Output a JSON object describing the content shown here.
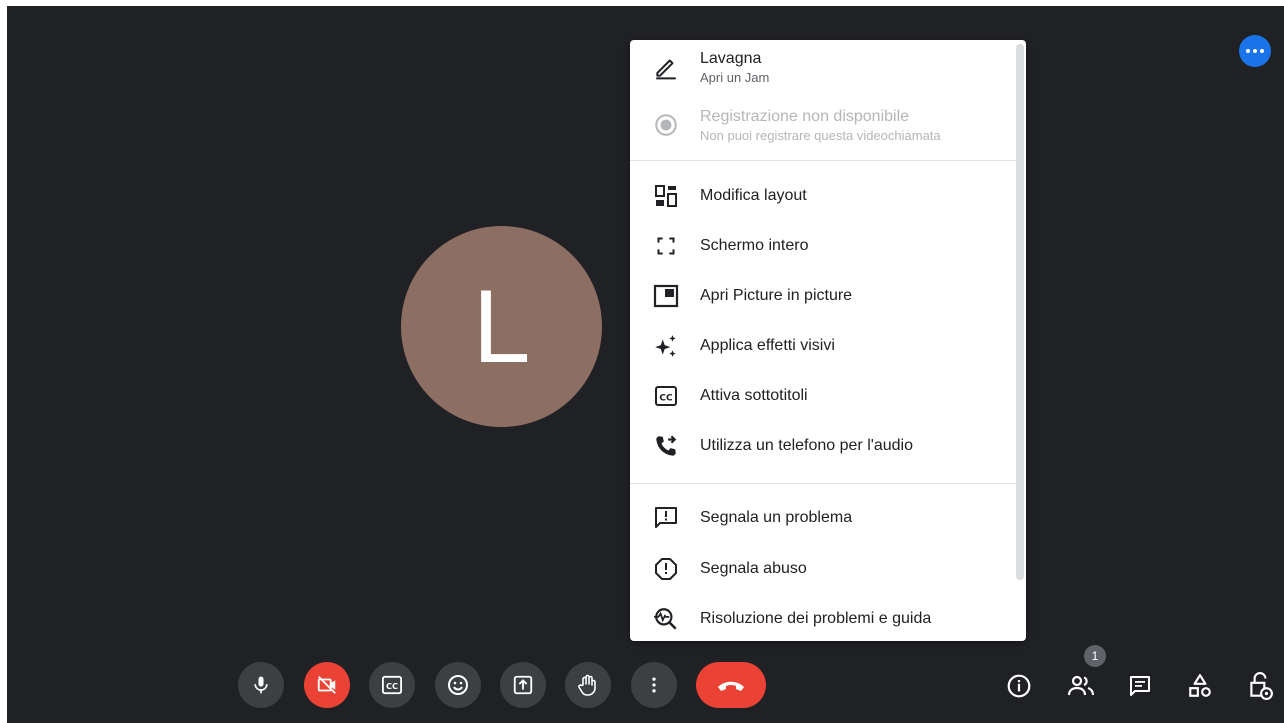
{
  "participant": {
    "initial": "L"
  },
  "menu": {
    "items": [
      {
        "label": "Lavagna",
        "sub": "Apri un Jam",
        "icon": "pencil-icon",
        "disabled": false
      },
      {
        "label": "Registrazione non disponibile",
        "sub": "Non puoi registrare questa videochiamata",
        "icon": "record-icon",
        "disabled": true
      },
      {
        "label": "Modifica layout",
        "icon": "layout-icon"
      },
      {
        "label": "Schermo intero",
        "icon": "fullscreen-icon"
      },
      {
        "label": "Apri Picture in picture",
        "icon": "picture-in-picture-icon"
      },
      {
        "label": "Applica effetti visivi",
        "icon": "sparkle-icon"
      },
      {
        "label": "Attiva sottotitoli",
        "icon": "captions-icon"
      },
      {
        "label": "Utilizza un telefono per l'audio",
        "icon": "phone-forward-icon"
      },
      {
        "label": "Segnala un problema",
        "icon": "feedback-icon"
      },
      {
        "label": "Segnala abuso",
        "icon": "report-icon"
      },
      {
        "label": "Risoluzione dei problemi e guida",
        "icon": "troubleshoot-icon"
      }
    ]
  },
  "bottom_bar": {
    "controls": [
      "mic-icon",
      "camera-off-icon",
      "captions-icon",
      "emoji-icon",
      "present-icon",
      "raise-hand-icon",
      "more-vert-icon",
      "end-call-icon"
    ],
    "right": [
      "info-icon",
      "people-icon",
      "chat-icon",
      "activities-icon",
      "host-controls-icon"
    ],
    "people_count": "1"
  },
  "colors": {
    "background": "#202124",
    "accent": "#1a73e8",
    "danger": "#ea4335",
    "avatar": "#8d6e63",
    "button": "#3c4043"
  }
}
